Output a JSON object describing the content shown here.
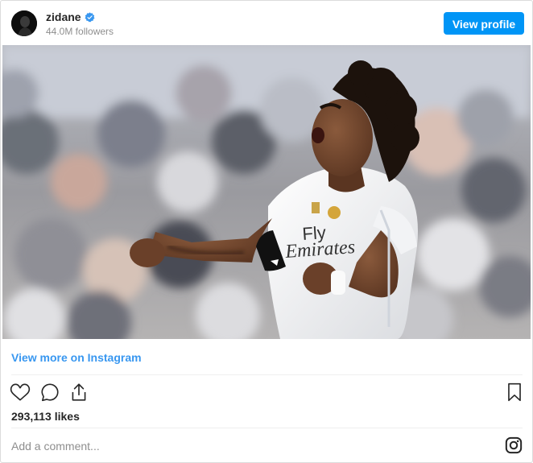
{
  "header": {
    "username": "zidane",
    "followers": "44.0M followers",
    "view_profile_label": "View profile",
    "verified_icon": "verified-badge-icon",
    "accent_color": "#0095f6"
  },
  "post": {
    "jersey_text_1": "Fly",
    "jersey_text_2": "Emirates",
    "view_more_label": "View more on Instagram",
    "likes": "293,113 likes"
  },
  "actions": {
    "like_icon": "heart-icon",
    "comment_icon": "comment-icon",
    "share_icon": "share-icon",
    "save_icon": "bookmark-icon"
  },
  "comment": {
    "placeholder": "Add a comment...",
    "instagram_icon": "instagram-icon"
  }
}
